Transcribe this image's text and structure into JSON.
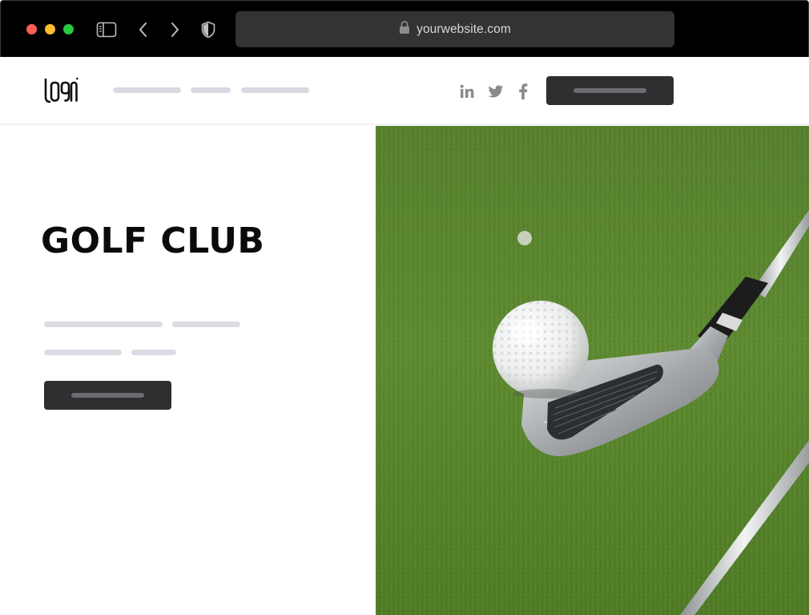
{
  "browser": {
    "url": "yourwebsite.com",
    "icons": [
      "sidebar-icon",
      "back-chevron-icon",
      "forward-chevron-icon",
      "shield-icon",
      "lock-icon"
    ]
  },
  "header": {
    "logo_icon": "logo-icon",
    "nav_items": [
      "",
      "",
      ""
    ],
    "social_icons": [
      "linkedin-icon",
      "twitter-icon",
      "facebook-icon"
    ]
  },
  "hero": {
    "title": "GOLF CLUB",
    "image": "golf-ball-on-club-photo"
  },
  "colors": {
    "chrome_background": "#000000",
    "url_bar": "#333333",
    "button": "#2f2f31",
    "placeholder_line": "#dcdce5",
    "grass": "#5e8a32"
  }
}
